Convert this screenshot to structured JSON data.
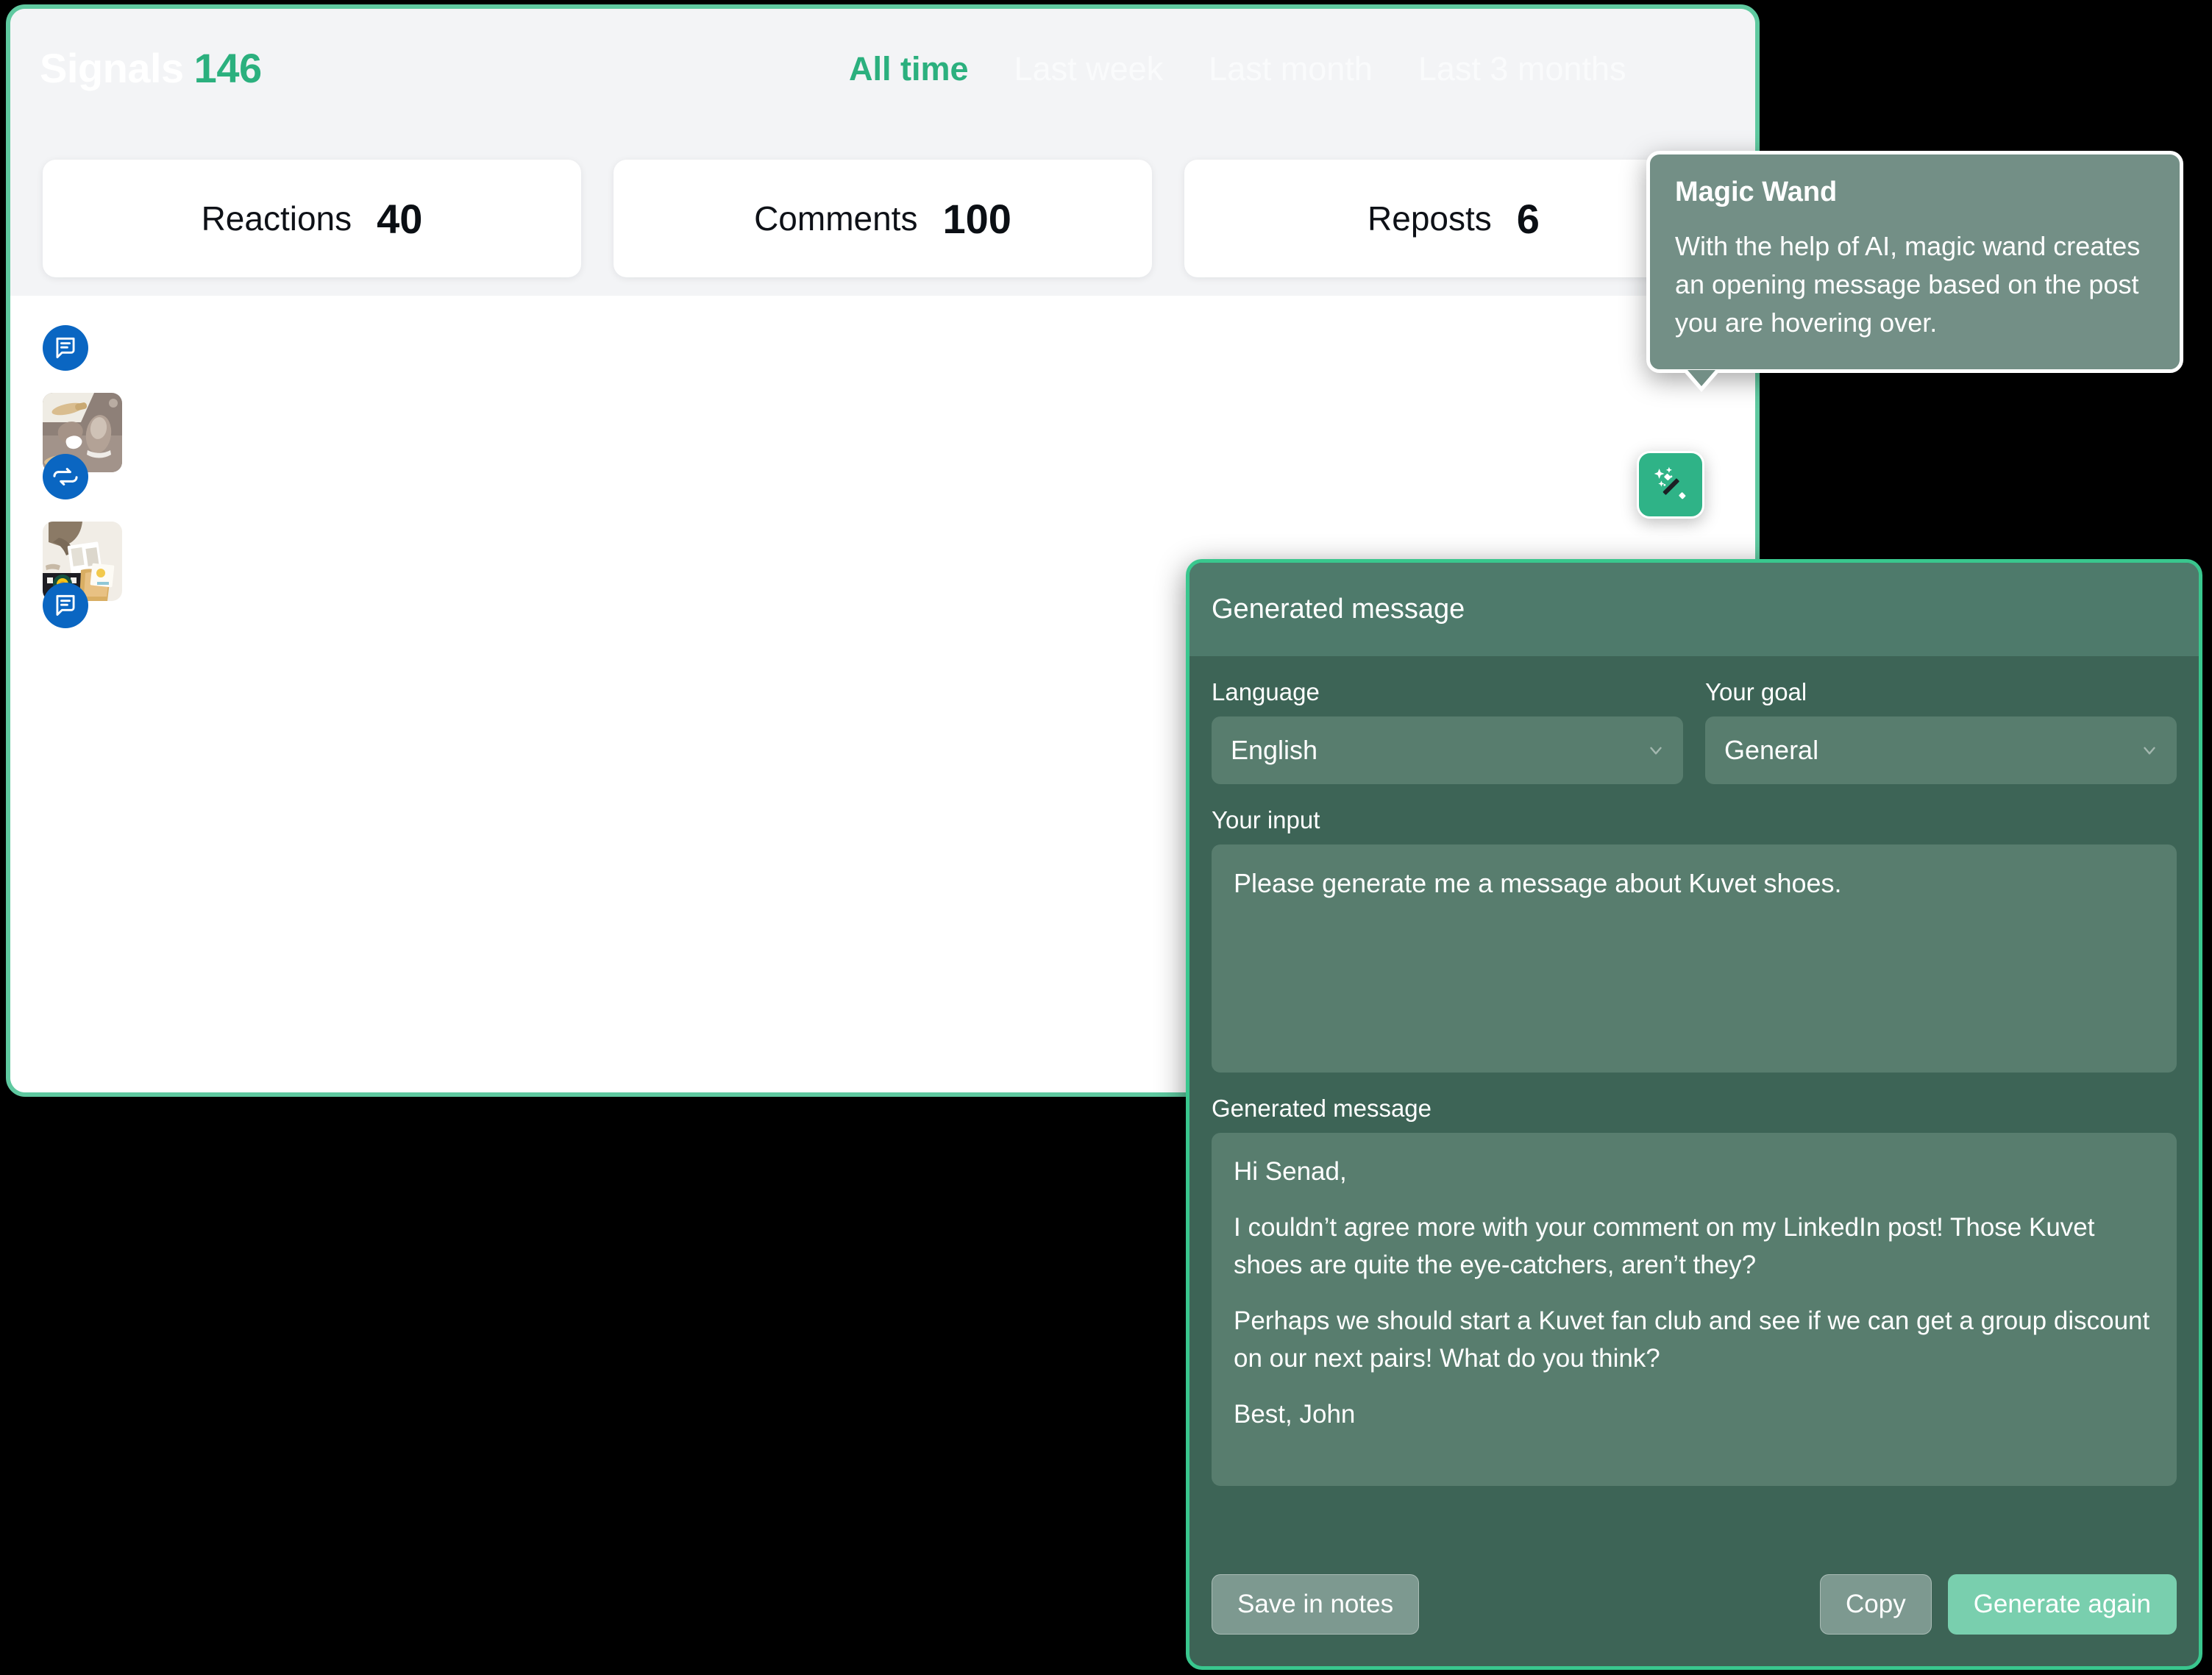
{
  "app": {
    "brand_word": "Signals",
    "brand_count": "146",
    "tabs": [
      {
        "label": "All time",
        "active": true
      },
      {
        "label": "Last week",
        "active": false
      },
      {
        "label": "Last month",
        "active": false
      },
      {
        "label": "Last 3 months",
        "active": false
      }
    ],
    "stats": [
      {
        "label": "Reactions",
        "value": "40"
      },
      {
        "label": "Comments",
        "value": "100"
      },
      {
        "label": "Reposts",
        "value": "6"
      }
    ],
    "feed": [
      {
        "icon": "comment-icon",
        "thumb": "kuvet-shoes-thumbnail"
      },
      {
        "icon": "repost-icon",
        "thumb": "cat-book-picnic-thumbnail"
      },
      {
        "icon": "comment-icon",
        "thumb": null
      }
    ]
  },
  "wand_button": {
    "icon": "magic-wand-icon"
  },
  "tooltip": {
    "title": "Magic Wand",
    "body": "With the help of AI, magic wand creates an opening message based on the post you are hovering over."
  },
  "generated_panel": {
    "header_title": "Generated message",
    "language": {
      "label": "Language",
      "value": "English",
      "chevron": "chevron-down-icon"
    },
    "goal": {
      "label": "Your goal",
      "value": "General",
      "chevron": "chevron-down-icon"
    },
    "input": {
      "label": "Your input",
      "value": "Please generate me a message about Kuvet shoes."
    },
    "output": {
      "label": "Generated message",
      "paragraphs": [
        "Hi Senad,",
        "I couldn’t agree more with your comment on my LinkedIn post!  Those Kuvet shoes are quite the eye-catchers, aren’t they?",
        "Perhaps we should start a Kuvet fan club and see if we can get a group discount on our next pairs! What do you think?",
        "Best, John"
      ]
    },
    "actions": {
      "save": "Save in notes",
      "copy": "Copy",
      "generate_again": "Generate again"
    }
  },
  "colors": {
    "brand_green": "#2bb07e",
    "card_border_green": "#5fc9a0",
    "panel_body": "#3d6456",
    "panel_header": "#4e7a6b",
    "panel_field": "#587d6e",
    "panel_border": "#39c78e",
    "tooltip_bg": "#738f86",
    "primary_button": "#79cfae",
    "secondary_button": "#7d9990",
    "badge_blue": "#0a66c2",
    "header_bg": "#f3f4f6",
    "page_bg": "#000000"
  }
}
